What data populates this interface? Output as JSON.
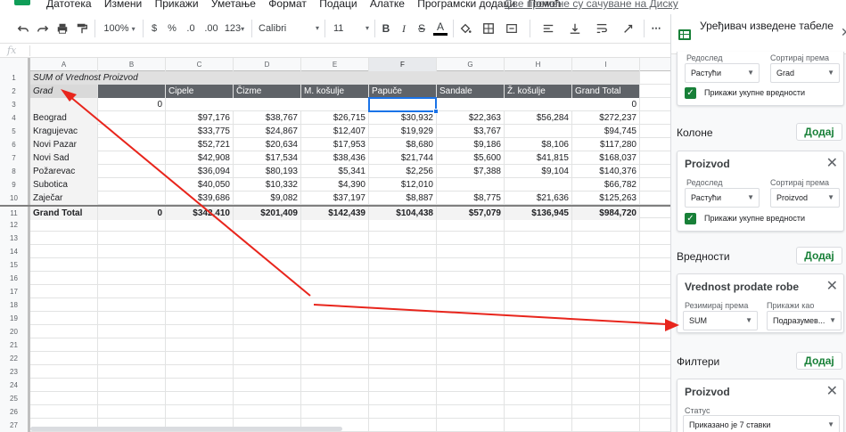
{
  "menubar": {
    "items": [
      "Датотека",
      "Измени",
      "Прикажи",
      "Уметање",
      "Формат",
      "Подаци",
      "Алатке",
      "Програмски додаци",
      "Помоћ"
    ],
    "save_status": "Све промене су сачуване на Диску"
  },
  "toolbar": {
    "zoom": "100%",
    "currency": "$",
    "percent": "%",
    "dec_less": ".0",
    "dec_more": ".00",
    "format": "123",
    "font": "Calibri",
    "font_size": "11",
    "bold": "B",
    "italic": "I",
    "strike": "S",
    "text_color": "A"
  },
  "formula_bar": {
    "fx": "fx",
    "value": ""
  },
  "grid": {
    "columns": [
      "A",
      "B",
      "C",
      "D",
      "E",
      "F",
      "G",
      "H",
      "I"
    ],
    "selected_column": "F",
    "row_numbers": [
      "1",
      "2",
      "3",
      "4",
      "5",
      "6",
      "7",
      "8",
      "9",
      "10",
      "11",
      "12",
      "13",
      "14",
      "15",
      "16",
      "17",
      "18",
      "19",
      "20",
      "21",
      "22",
      "23",
      "24",
      "25",
      "26",
      "27"
    ],
    "pivot_title": "SUM of Vredност Proizvod",
    "pivot_title_exact": "SUM of Vrednost Proizvod",
    "header_label": "Grad",
    "header_cols": [
      "",
      "Cipele",
      "Čizme",
      "M. košulje",
      "Papuče",
      "Sandale",
      "Ž. košulje",
      "Grand Total"
    ],
    "row3": {
      "b": "0",
      "i": "0"
    },
    "data_rows": [
      {
        "grad": "Beograd",
        "vals": [
          "",
          "$97,176",
          "$38,767",
          "$26,715",
          "$30,932",
          "$22,363",
          "$56,284",
          "$272,237"
        ]
      },
      {
        "grad": "Kragujevac",
        "vals": [
          "",
          "$33,775",
          "$24,867",
          "$12,407",
          "$19,929",
          "$3,767",
          "",
          "$94,745"
        ]
      },
      {
        "grad": "Novi Pazar",
        "vals": [
          "",
          "$52,721",
          "$20,634",
          "$17,953",
          "$8,680",
          "$9,186",
          "$8,106",
          "$117,280"
        ]
      },
      {
        "grad": "Novi Sad",
        "vals": [
          "",
          "$42,908",
          "$17,534",
          "$38,436",
          "$21,744",
          "$5,600",
          "$41,815",
          "$168,037"
        ]
      },
      {
        "grad": "Požarevac",
        "vals": [
          "",
          "$36,094",
          "$80,193",
          "$5,341",
          "$2,256",
          "$7,388",
          "$9,104",
          "$140,376"
        ]
      },
      {
        "grad": "Subotica",
        "vals": [
          "",
          "$40,050",
          "$10,332",
          "$4,390",
          "$12,010",
          "",
          "",
          "$66,782"
        ]
      },
      {
        "grad": "Zaječar",
        "vals": [
          "",
          "$39,686",
          "$9,082",
          "$37,197",
          "$8,887",
          "$8,775",
          "$21,636",
          "$125,263"
        ]
      }
    ],
    "total_row": {
      "label": "Grand Total",
      "vals": [
        "0",
        "$342,410",
        "$201,409",
        "$142,439",
        "$104,438",
        "$57,079",
        "$136,945",
        "$984,720"
      ]
    }
  },
  "panel": {
    "title": "Уређивач изведене табеле",
    "rows_card": {
      "order_label": "Редослед",
      "order_value": "Растући",
      "sort_label": "Сортирај према",
      "sort_value": "Grad",
      "totals_label": "Прикажи укупне вредности"
    },
    "columns_section": "Колоне",
    "add_label": "Додај",
    "columns_card": {
      "title": "Proizvod",
      "order_label": "Редослед",
      "order_value": "Растући",
      "sort_label": "Сортирај према",
      "sort_value": "Proizvod",
      "totals_label": "Прикажи укупне вредности"
    },
    "values_section": "Вредности",
    "values_card": {
      "title": "Vrednost prodate robe",
      "summarize_label": "Резимирај према",
      "summarize_value": "SUM",
      "show_as_label": "Прикажи као",
      "show_as_value": "Подразумев..."
    },
    "filters_section": "Филтери",
    "filters_card": {
      "title": "Proizvod",
      "status_label": "Статус",
      "status_value": "Приказано је 7 ставки"
    }
  },
  "annotation_color": "#e8251c"
}
